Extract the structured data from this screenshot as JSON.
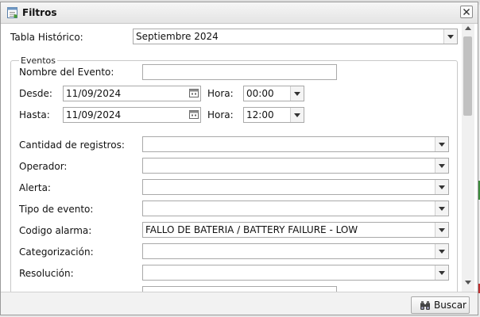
{
  "dialog": {
    "title": "Filtros"
  },
  "tabla": {
    "label": "Tabla Histórico:",
    "value": "Septiembre 2024"
  },
  "eventos": {
    "legend": "Eventos",
    "nombre_label": "Nombre del Evento:",
    "nombre_value": "",
    "desde_label": "Desde:",
    "desde_date": "11/09/2024",
    "desde_hora_label": "Hora:",
    "desde_hora": "00:00",
    "hasta_label": "Hasta:",
    "hasta_date": "11/09/2024",
    "hasta_hora_label": "Hora:",
    "hasta_hora": "12:00",
    "cantidad_label": "Cantidad de registros:",
    "cantidad_value": "",
    "operador_label": "Operador:",
    "operador_value": "",
    "alerta_label": "Alerta:",
    "alerta_value": "",
    "tipo_label": "Tipo de evento:",
    "tipo_value": "",
    "codigo_label": "Codigo alarma:",
    "codigo_value": "FALLO DE BATERIA / BATTERY FAILURE - LOW",
    "categorizacion_label": "Categorización:",
    "categorizacion_value": "",
    "resolucion_label": "Resolución:",
    "resolucion_value": ""
  },
  "footer": {
    "buscar_label": "Buscar"
  },
  "icons": {
    "title": "filter-window-icon",
    "close": "close-icon",
    "calendar": "calendar-icon",
    "dropdown": "chevron-down-icon",
    "buscar": "binoculars-icon"
  }
}
